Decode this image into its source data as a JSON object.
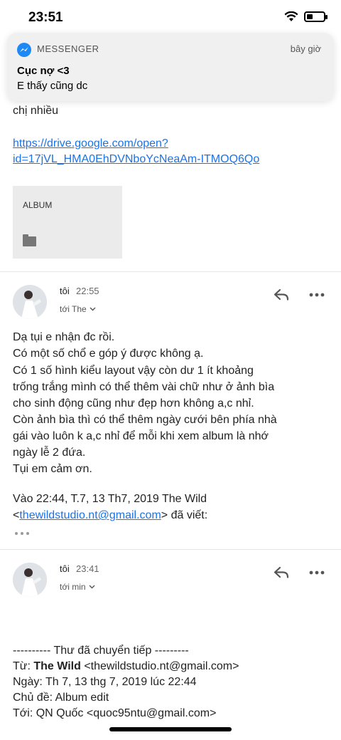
{
  "status_bar": {
    "time": "23:51",
    "battery_level": 0.35
  },
  "notification": {
    "app_name": "MESSENGER",
    "time": "bây giờ",
    "title": "Cục nợ <3",
    "body": "E thấy cũng dc"
  },
  "previous_message": {
    "fragment": "chị nhiều",
    "link_line1": "https://drive.google.com/open?",
    "link_line2": "id=17jVL_HMA0EhDVNboYcNeaAm-ITMOQ6Qo",
    "attachment_label": "ALBUM"
  },
  "message1": {
    "sender": "tôi",
    "time": "22:55",
    "recipient": "tới The",
    "body_lines": [
      "Dạ tụi e nhận đc rồi.",
      "Có một số chổ e góp ý được không ạ.",
      "Có 1 số hình kiểu layout vậy còn dư 1 ít khoảng",
      "trống trắng mình có thể thêm vài chữ như ở ảnh bìa",
      "cho sinh động cũng như đẹp hơn không a,c nhỉ.",
      "Còn ảnh bìa thì có thể thêm ngày cưới bên phía nhà",
      "gái vào luôn k a,c nhỉ để mỗi khi xem album là nhớ",
      "ngày lễ 2 đứa.",
      "Tụi em cảm ơn."
    ],
    "quote_intro": "Vào 22:44, T.7, 13 Th7, 2019 The Wild",
    "quote_lt": "<",
    "quote_email": "thewildstudio.nt@gmail.com",
    "quote_tail": "> đã viết:"
  },
  "message2": {
    "sender": "tôi",
    "time": "23:41",
    "recipient": "tới min",
    "forward_header": "---------- Thư đã chuyển tiếp ---------",
    "from_label": "Từ: ",
    "from_name": "The Wild",
    "from_email": " <thewildstudio.nt@gmail.com>",
    "date_line": "Ngày: Th 7, 13 thg 7, 2019 lúc 22:44",
    "subject_line": "Chủ đề: Album edit",
    "to_line": "Tới: QN Quốc <quoc95ntu@gmail.com>"
  },
  "icons": {
    "messenger": "messenger-icon",
    "reply": "reply-icon",
    "more": "more-icon",
    "folder": "folder-icon",
    "chevron": "chevron-down-icon"
  },
  "colors": {
    "link": "#1a73e8",
    "messenger_blue": "#1e88f5"
  }
}
